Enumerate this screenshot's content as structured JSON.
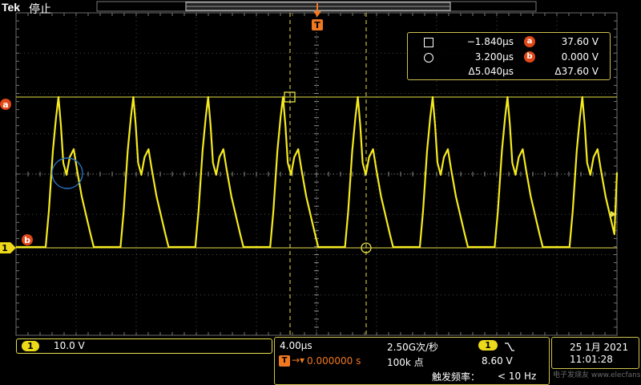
{
  "header": {
    "brand": "Tek",
    "status": "停止"
  },
  "markers": {
    "trigger": "T",
    "cursor_a": "a",
    "cursor_b": "b",
    "channel": "1"
  },
  "cursor_readout": {
    "row1": {
      "time": "−1.840µs",
      "badge": "a",
      "value": "37.60 V"
    },
    "row2": {
      "time": "3.200µs",
      "badge": "b",
      "value": "0.000 V"
    },
    "row3": {
      "delta_time": "Δ5.040µs",
      "delta_value": "Δ37.60 V"
    }
  },
  "channel1": {
    "label": "1",
    "scale": "10.0 V"
  },
  "timebase": {
    "scale": "4.00µs",
    "sample_rate": "2.50G次/秒",
    "trigger_position": "0.000000 s",
    "record_length": "100k 点",
    "trigger_source": "1",
    "trigger_slope_icon": "falling-edge-icon",
    "trigger_level": "8.60 V",
    "trigger_freq_label": "触发频率：",
    "trigger_freq_value": "< 10 Hz"
  },
  "datetime": {
    "date": "25 1月 2021",
    "time": "11:01:28"
  },
  "watermark": "电子发烧友 www.elecfans.com",
  "colors": {
    "trace": "#f5ea1e",
    "cursor": "#e8df4a",
    "badge": "#e04818",
    "grid": "#5a5a5a"
  }
}
